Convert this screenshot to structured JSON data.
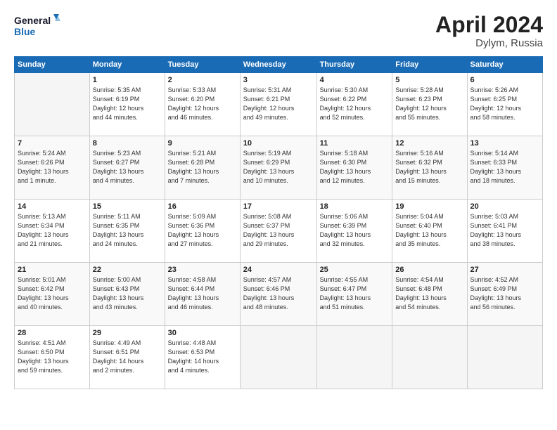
{
  "header": {
    "logo_line1": "General",
    "logo_line2": "Blue",
    "month_year": "April 2024",
    "location": "Dylym, Russia"
  },
  "weekdays": [
    "Sunday",
    "Monday",
    "Tuesday",
    "Wednesday",
    "Thursday",
    "Friday",
    "Saturday"
  ],
  "weeks": [
    [
      {
        "day": "",
        "info": ""
      },
      {
        "day": "1",
        "info": "Sunrise: 5:35 AM\nSunset: 6:19 PM\nDaylight: 12 hours\nand 44 minutes."
      },
      {
        "day": "2",
        "info": "Sunrise: 5:33 AM\nSunset: 6:20 PM\nDaylight: 12 hours\nand 46 minutes."
      },
      {
        "day": "3",
        "info": "Sunrise: 5:31 AM\nSunset: 6:21 PM\nDaylight: 12 hours\nand 49 minutes."
      },
      {
        "day": "4",
        "info": "Sunrise: 5:30 AM\nSunset: 6:22 PM\nDaylight: 12 hours\nand 52 minutes."
      },
      {
        "day": "5",
        "info": "Sunrise: 5:28 AM\nSunset: 6:23 PM\nDaylight: 12 hours\nand 55 minutes."
      },
      {
        "day": "6",
        "info": "Sunrise: 5:26 AM\nSunset: 6:25 PM\nDaylight: 12 hours\nand 58 minutes."
      }
    ],
    [
      {
        "day": "7",
        "info": "Sunrise: 5:24 AM\nSunset: 6:26 PM\nDaylight: 13 hours\nand 1 minute."
      },
      {
        "day": "8",
        "info": "Sunrise: 5:23 AM\nSunset: 6:27 PM\nDaylight: 13 hours\nand 4 minutes."
      },
      {
        "day": "9",
        "info": "Sunrise: 5:21 AM\nSunset: 6:28 PM\nDaylight: 13 hours\nand 7 minutes."
      },
      {
        "day": "10",
        "info": "Sunrise: 5:19 AM\nSunset: 6:29 PM\nDaylight: 13 hours\nand 10 minutes."
      },
      {
        "day": "11",
        "info": "Sunrise: 5:18 AM\nSunset: 6:30 PM\nDaylight: 13 hours\nand 12 minutes."
      },
      {
        "day": "12",
        "info": "Sunrise: 5:16 AM\nSunset: 6:32 PM\nDaylight: 13 hours\nand 15 minutes."
      },
      {
        "day": "13",
        "info": "Sunrise: 5:14 AM\nSunset: 6:33 PM\nDaylight: 13 hours\nand 18 minutes."
      }
    ],
    [
      {
        "day": "14",
        "info": "Sunrise: 5:13 AM\nSunset: 6:34 PM\nDaylight: 13 hours\nand 21 minutes."
      },
      {
        "day": "15",
        "info": "Sunrise: 5:11 AM\nSunset: 6:35 PM\nDaylight: 13 hours\nand 24 minutes."
      },
      {
        "day": "16",
        "info": "Sunrise: 5:09 AM\nSunset: 6:36 PM\nDaylight: 13 hours\nand 27 minutes."
      },
      {
        "day": "17",
        "info": "Sunrise: 5:08 AM\nSunset: 6:37 PM\nDaylight: 13 hours\nand 29 minutes."
      },
      {
        "day": "18",
        "info": "Sunrise: 5:06 AM\nSunset: 6:39 PM\nDaylight: 13 hours\nand 32 minutes."
      },
      {
        "day": "19",
        "info": "Sunrise: 5:04 AM\nSunset: 6:40 PM\nDaylight: 13 hours\nand 35 minutes."
      },
      {
        "day": "20",
        "info": "Sunrise: 5:03 AM\nSunset: 6:41 PM\nDaylight: 13 hours\nand 38 minutes."
      }
    ],
    [
      {
        "day": "21",
        "info": "Sunrise: 5:01 AM\nSunset: 6:42 PM\nDaylight: 13 hours\nand 40 minutes."
      },
      {
        "day": "22",
        "info": "Sunrise: 5:00 AM\nSunset: 6:43 PM\nDaylight: 13 hours\nand 43 minutes."
      },
      {
        "day": "23",
        "info": "Sunrise: 4:58 AM\nSunset: 6:44 PM\nDaylight: 13 hours\nand 46 minutes."
      },
      {
        "day": "24",
        "info": "Sunrise: 4:57 AM\nSunset: 6:46 PM\nDaylight: 13 hours\nand 48 minutes."
      },
      {
        "day": "25",
        "info": "Sunrise: 4:55 AM\nSunset: 6:47 PM\nDaylight: 13 hours\nand 51 minutes."
      },
      {
        "day": "26",
        "info": "Sunrise: 4:54 AM\nSunset: 6:48 PM\nDaylight: 13 hours\nand 54 minutes."
      },
      {
        "day": "27",
        "info": "Sunrise: 4:52 AM\nSunset: 6:49 PM\nDaylight: 13 hours\nand 56 minutes."
      }
    ],
    [
      {
        "day": "28",
        "info": "Sunrise: 4:51 AM\nSunset: 6:50 PM\nDaylight: 13 hours\nand 59 minutes."
      },
      {
        "day": "29",
        "info": "Sunrise: 4:49 AM\nSunset: 6:51 PM\nDaylight: 14 hours\nand 2 minutes."
      },
      {
        "day": "30",
        "info": "Sunrise: 4:48 AM\nSunset: 6:53 PM\nDaylight: 14 hours\nand 4 minutes."
      },
      {
        "day": "",
        "info": ""
      },
      {
        "day": "",
        "info": ""
      },
      {
        "day": "",
        "info": ""
      },
      {
        "day": "",
        "info": ""
      }
    ]
  ]
}
